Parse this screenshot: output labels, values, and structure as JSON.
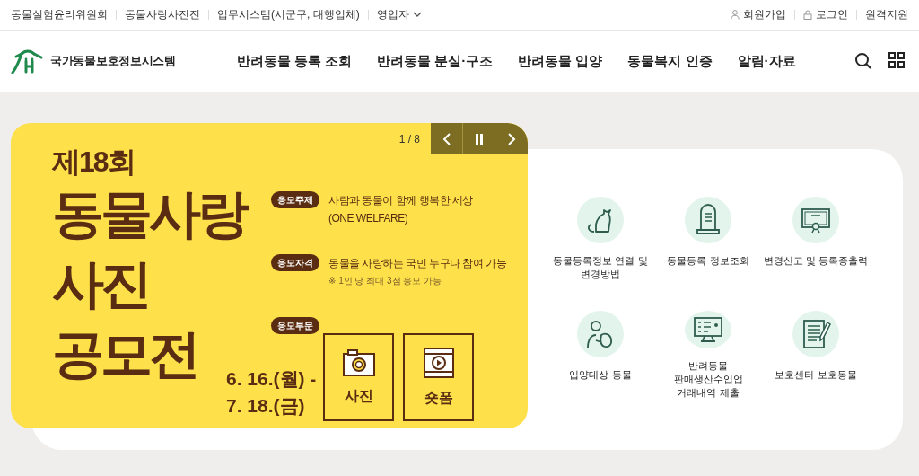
{
  "top_bar": {
    "left_links": [
      {
        "label": "동물실험윤리위원회",
        "kind": "link"
      },
      {
        "label": "동물사랑사진전",
        "kind": "link"
      },
      {
        "label": "업무시스템(시군구, 대행업체)",
        "kind": "link"
      },
      {
        "label": "영업자",
        "kind": "dropdown"
      }
    ],
    "right_links": [
      {
        "label": "회원가입",
        "kind": "user"
      },
      {
        "label": "로그인",
        "kind": "lock"
      },
      {
        "label": "원격지원",
        "kind": "text"
      }
    ]
  },
  "header": {
    "logo_text": "국가동물보호정보시스템",
    "nav": [
      "반려동물 등록 조회",
      "반려동물 분실·구조",
      "반려동물 입양",
      "동물복지 인증",
      "알림·자료"
    ]
  },
  "banner": {
    "counter": "1 / 8",
    "edition": "제18회",
    "title_lines": [
      "동물사랑",
      "사진",
      "공모전"
    ],
    "items": [
      {
        "tag": "응모주제",
        "lines": [
          "사람과 동물이 함께 행복한 세상",
          "(ONE WELFARE)"
        ]
      },
      {
        "tag": "응모자격",
        "lines": [
          "동물을 사랑하는 국민 누구나 참여 가능"
        ],
        "note": "※ 1인 당 최대 3점 응모 가능"
      },
      {
        "tag": "응모부문"
      }
    ],
    "dates": [
      "6. 16.(월) -",
      "7. 18.(금)"
    ],
    "categories": [
      {
        "label": "사진",
        "kind": "photo"
      },
      {
        "label": "숏폼",
        "kind": "video"
      }
    ]
  },
  "quick_links": [
    {
      "lines": [
        "동물등록정보 연결 및",
        "변경방법"
      ],
      "kind": "pet"
    },
    {
      "lines": [
        "동물등록 정보조회"
      ],
      "kind": "record"
    },
    {
      "lines": [
        "변경신고 및 등록증출력"
      ],
      "kind": "certificate"
    },
    {
      "lines": [
        "입양대상 동물"
      ],
      "kind": "adoption"
    },
    {
      "lines": [
        "반려동물",
        "판매생산수입업",
        "거래내역 제출"
      ],
      "kind": "monitor"
    },
    {
      "lines": [
        "보호센터 보호동물"
      ],
      "kind": "document"
    }
  ]
}
